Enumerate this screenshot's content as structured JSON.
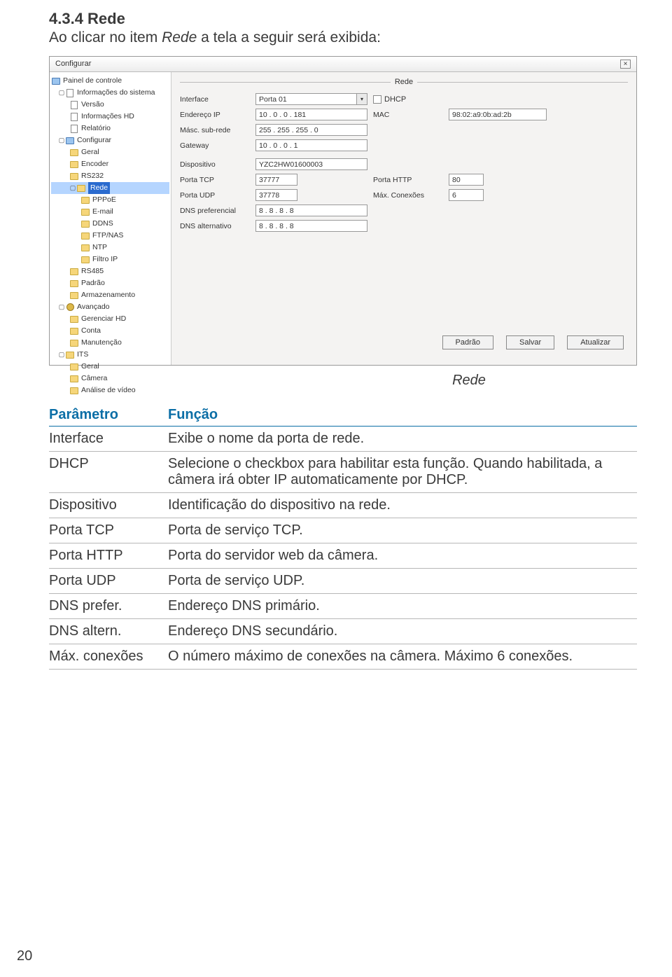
{
  "section": {
    "heading": "4.3.4 Rede",
    "intro_prefix": "Ao clicar no item ",
    "intro_italic": "Rede",
    "intro_suffix": " a tela a seguir será exibida:",
    "caption": "Rede",
    "page_number": "20"
  },
  "window": {
    "title": "Configurar",
    "close": "×",
    "tree": {
      "painel": "Painel de controle",
      "info": "Informações do sistema",
      "versao": "Versão",
      "infohd": "Informações HD",
      "relatorio": "Relatório",
      "configurar": "Configurar",
      "geral": "Geral",
      "encoder": "Encoder",
      "rs232": "RS232",
      "rede": "Rede",
      "pppoe": "PPPoE",
      "email": "E-mail",
      "ddns": "DDNS",
      "ftp": "FTP/NAS",
      "ntp": "NTP",
      "filtroip": "Filtro IP",
      "rs485": "RS485",
      "padrao": "Padrão",
      "armaz": "Armazenamento",
      "avancado": "Avançado",
      "gerhd": "Gerenciar HD",
      "conta": "Conta",
      "manut": "Manutenção",
      "its": "ITS",
      "its_geral": "Geral",
      "its_cam": "Câmera",
      "its_analise": "Análise de vídeo"
    },
    "pane_title": "Rede",
    "form": {
      "interface": "Interface",
      "interface_val": "Porta 01",
      "dhcp": "DHCP",
      "enderecoip": "Endereço IP",
      "enderecoip_val": "10  .  0  .  0  . 181",
      "mac": "MAC",
      "mac_val": "98:02:a9:0b:ad:2b",
      "masc": "Másc. sub-rede",
      "masc_val": "255 . 255 . 255 .  0",
      "gateway": "Gateway",
      "gateway_val": "10  .  0  .  0  .  1",
      "dispositivo": "Dispositivo",
      "dispositivo_val": "YZC2HW01600003",
      "portatcp": "Porta TCP",
      "portatcp_val": "37777",
      "portahttp": "Porta HTTP",
      "portahttp_val": "80",
      "portaudp": "Porta UDP",
      "portaudp_val": "37778",
      "maxcon": "Máx. Conexões",
      "maxcon_val": "6",
      "dnspref": "DNS preferencial",
      "dnspref_val": "8  .  8  .  8  .  8",
      "dnsalt": "DNS alternativo",
      "dnsalt_val": "8  .  8  .  8  .  8"
    },
    "buttons": {
      "padrao": "Padrão",
      "salvar": "Salvar",
      "atualizar": "Atualizar"
    }
  },
  "table": {
    "header_param": "Parâmetro",
    "header_funcao": "Função",
    "rows": [
      {
        "param": "Interface",
        "desc": "Exibe o nome da porta de rede."
      },
      {
        "param": "DHCP",
        "desc": "Selecione o checkbox para habilitar esta função. Quando habilitada, a câmera irá obter IP automaticamente por DHCP."
      },
      {
        "param": "Dispositivo",
        "desc": "Identificação do dispositivo na rede."
      },
      {
        "param": "Porta TCP",
        "desc": "Porta de serviço TCP."
      },
      {
        "param": "Porta HTTP",
        "desc": "Porta do servidor web da câmera."
      },
      {
        "param": "Porta UDP",
        "desc": "Porta de serviço UDP."
      },
      {
        "param": "DNS prefer.",
        "desc": "Endereço DNS primário."
      },
      {
        "param": "DNS altern.",
        "desc": "Endereço DNS secundário."
      },
      {
        "param": "Máx. conexões",
        "desc": "O número máximo de conexões na câmera. Máximo 6 conexões."
      }
    ]
  }
}
